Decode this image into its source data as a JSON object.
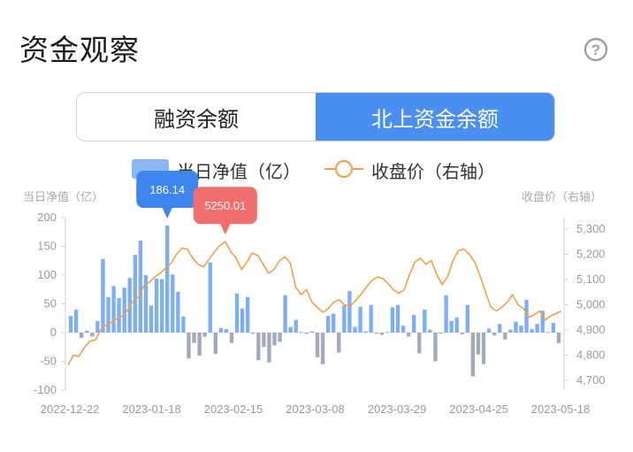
{
  "header": {
    "title": "资金观察",
    "help_icon": "question-circle-icon"
  },
  "tabs": [
    {
      "label": "融资余额",
      "active": false
    },
    {
      "label": "北上资金余额",
      "active": true
    }
  ],
  "colors": {
    "accent": "#4a8ef0",
    "bar_positive": "#7eaef3",
    "bar_negative": "#a3aab9",
    "line": "#f0a04b",
    "callout_bar": "#3d86ee",
    "callout_line": "#f26d6d"
  },
  "chart_data": {
    "type": "bar+line",
    "legend": {
      "bar_label": "当日净值（亿）",
      "line_label": "收盘价（右轴）"
    },
    "left_axis_title": "当日净值（亿）",
    "right_axis_title": "收盘价（右轴）",
    "left_ticks": [
      "200",
      "150",
      "100",
      "50",
      "0",
      "-50",
      "-100"
    ],
    "right_ticks": [
      "5,300",
      "5,200",
      "5,100",
      "5,000",
      "4,900",
      "4,800",
      "4,700"
    ],
    "ylim_left": [
      -100,
      200
    ],
    "ylim_right": [
      4650,
      5350
    ],
    "x_labels": [
      "2022-12-22",
      "2023-01-18",
      "2023-02-15",
      "2023-03-08",
      "2023-03-29",
      "2023-04-25",
      "2023-05-18"
    ],
    "bars": [
      29,
      40,
      -9,
      3,
      -7,
      20,
      128,
      62,
      81,
      60,
      78,
      95,
      135,
      160,
      100,
      47,
      94,
      93,
      186.14,
      101,
      71,
      28,
      -45,
      -18,
      -40,
      -7,
      122,
      -37,
      8,
      6,
      -18,
      68,
      42,
      62,
      -2,
      -48,
      -25,
      -52,
      -22,
      -16,
      65,
      10,
      22,
      1,
      -2,
      2,
      -43,
      -55,
      29,
      33,
      -35,
      47,
      72,
      10,
      45,
      2,
      48,
      -2,
      -4,
      1,
      44,
      48,
      12,
      -7,
      31,
      -36,
      40,
      5,
      -50,
      0,
      65,
      20,
      26,
      -3,
      48,
      -76,
      -38,
      -55,
      7,
      -5,
      15,
      -12,
      5,
      19,
      12,
      57,
      6,
      15,
      38,
      1,
      17,
      -18
    ],
    "close": [
      4760,
      4800,
      4795,
      4830,
      4855,
      4860,
      4900,
      4920,
      4930,
      4945,
      4955,
      4980,
      5015,
      5030,
      5075,
      5090,
      5110,
      5125,
      5145,
      5165,
      5200,
      5225,
      5220,
      5185,
      5160,
      5150,
      5180,
      5210,
      5235,
      5250.01,
      5210,
      5185,
      5140,
      5170,
      5205,
      5195,
      5160,
      5125,
      5140,
      5175,
      5190,
      5165,
      5070,
      5040,
      5060,
      5010,
      4990,
      4970,
      4985,
      5010,
      5020,
      5000,
      4995,
      5015,
      5040,
      5070,
      5095,
      5110,
      5105,
      5085,
      5060,
      5045,
      5060,
      5120,
      5170,
      5185,
      5160,
      5175,
      5120,
      5080,
      5110,
      5175,
      5215,
      5220,
      5200,
      5170,
      5115,
      5050,
      4990,
      4975,
      4990,
      5010,
      5040,
      5000,
      4985,
      4950,
      4960,
      4975,
      4940,
      4955,
      4965,
      4975
    ],
    "callouts": [
      {
        "series": "bar",
        "index": 18,
        "label": "186.14"
      },
      {
        "series": "line",
        "index": 29,
        "label": "5250.01"
      }
    ]
  }
}
